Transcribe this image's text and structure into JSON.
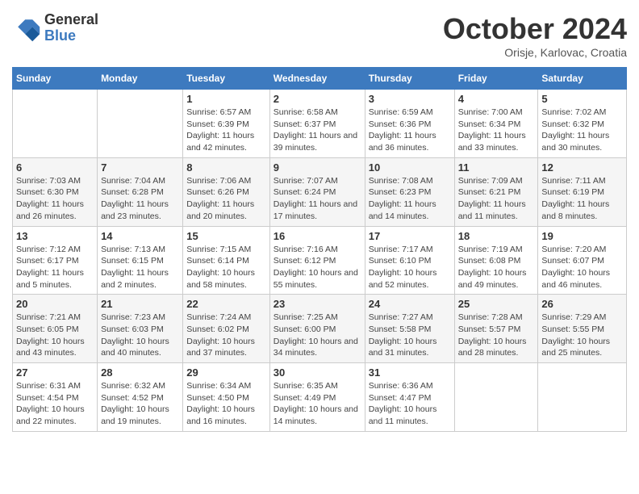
{
  "header": {
    "logo_line1": "General",
    "logo_line2": "Blue",
    "month": "October 2024",
    "location": "Orisje, Karlovac, Croatia"
  },
  "weekdays": [
    "Sunday",
    "Monday",
    "Tuesday",
    "Wednesday",
    "Thursday",
    "Friday",
    "Saturday"
  ],
  "weeks": [
    [
      {
        "day": "",
        "sunrise": "",
        "sunset": "",
        "daylight": ""
      },
      {
        "day": "",
        "sunrise": "",
        "sunset": "",
        "daylight": ""
      },
      {
        "day": "1",
        "sunrise": "Sunrise: 6:57 AM",
        "sunset": "Sunset: 6:39 PM",
        "daylight": "Daylight: 11 hours and 42 minutes."
      },
      {
        "day": "2",
        "sunrise": "Sunrise: 6:58 AM",
        "sunset": "Sunset: 6:37 PM",
        "daylight": "Daylight: 11 hours and 39 minutes."
      },
      {
        "day": "3",
        "sunrise": "Sunrise: 6:59 AM",
        "sunset": "Sunset: 6:36 PM",
        "daylight": "Daylight: 11 hours and 36 minutes."
      },
      {
        "day": "4",
        "sunrise": "Sunrise: 7:00 AM",
        "sunset": "Sunset: 6:34 PM",
        "daylight": "Daylight: 11 hours and 33 minutes."
      },
      {
        "day": "5",
        "sunrise": "Sunrise: 7:02 AM",
        "sunset": "Sunset: 6:32 PM",
        "daylight": "Daylight: 11 hours and 30 minutes."
      }
    ],
    [
      {
        "day": "6",
        "sunrise": "Sunrise: 7:03 AM",
        "sunset": "Sunset: 6:30 PM",
        "daylight": "Daylight: 11 hours and 26 minutes."
      },
      {
        "day": "7",
        "sunrise": "Sunrise: 7:04 AM",
        "sunset": "Sunset: 6:28 PM",
        "daylight": "Daylight: 11 hours and 23 minutes."
      },
      {
        "day": "8",
        "sunrise": "Sunrise: 7:06 AM",
        "sunset": "Sunset: 6:26 PM",
        "daylight": "Daylight: 11 hours and 20 minutes."
      },
      {
        "day": "9",
        "sunrise": "Sunrise: 7:07 AM",
        "sunset": "Sunset: 6:24 PM",
        "daylight": "Daylight: 11 hours and 17 minutes."
      },
      {
        "day": "10",
        "sunrise": "Sunrise: 7:08 AM",
        "sunset": "Sunset: 6:23 PM",
        "daylight": "Daylight: 11 hours and 14 minutes."
      },
      {
        "day": "11",
        "sunrise": "Sunrise: 7:09 AM",
        "sunset": "Sunset: 6:21 PM",
        "daylight": "Daylight: 11 hours and 11 minutes."
      },
      {
        "day": "12",
        "sunrise": "Sunrise: 7:11 AM",
        "sunset": "Sunset: 6:19 PM",
        "daylight": "Daylight: 11 hours and 8 minutes."
      }
    ],
    [
      {
        "day": "13",
        "sunrise": "Sunrise: 7:12 AM",
        "sunset": "Sunset: 6:17 PM",
        "daylight": "Daylight: 11 hours and 5 minutes."
      },
      {
        "day": "14",
        "sunrise": "Sunrise: 7:13 AM",
        "sunset": "Sunset: 6:15 PM",
        "daylight": "Daylight: 11 hours and 2 minutes."
      },
      {
        "day": "15",
        "sunrise": "Sunrise: 7:15 AM",
        "sunset": "Sunset: 6:14 PM",
        "daylight": "Daylight: 10 hours and 58 minutes."
      },
      {
        "day": "16",
        "sunrise": "Sunrise: 7:16 AM",
        "sunset": "Sunset: 6:12 PM",
        "daylight": "Daylight: 10 hours and 55 minutes."
      },
      {
        "day": "17",
        "sunrise": "Sunrise: 7:17 AM",
        "sunset": "Sunset: 6:10 PM",
        "daylight": "Daylight: 10 hours and 52 minutes."
      },
      {
        "day": "18",
        "sunrise": "Sunrise: 7:19 AM",
        "sunset": "Sunset: 6:08 PM",
        "daylight": "Daylight: 10 hours and 49 minutes."
      },
      {
        "day": "19",
        "sunrise": "Sunrise: 7:20 AM",
        "sunset": "Sunset: 6:07 PM",
        "daylight": "Daylight: 10 hours and 46 minutes."
      }
    ],
    [
      {
        "day": "20",
        "sunrise": "Sunrise: 7:21 AM",
        "sunset": "Sunset: 6:05 PM",
        "daylight": "Daylight: 10 hours and 43 minutes."
      },
      {
        "day": "21",
        "sunrise": "Sunrise: 7:23 AM",
        "sunset": "Sunset: 6:03 PM",
        "daylight": "Daylight: 10 hours and 40 minutes."
      },
      {
        "day": "22",
        "sunrise": "Sunrise: 7:24 AM",
        "sunset": "Sunset: 6:02 PM",
        "daylight": "Daylight: 10 hours and 37 minutes."
      },
      {
        "day": "23",
        "sunrise": "Sunrise: 7:25 AM",
        "sunset": "Sunset: 6:00 PM",
        "daylight": "Daylight: 10 hours and 34 minutes."
      },
      {
        "day": "24",
        "sunrise": "Sunrise: 7:27 AM",
        "sunset": "Sunset: 5:58 PM",
        "daylight": "Daylight: 10 hours and 31 minutes."
      },
      {
        "day": "25",
        "sunrise": "Sunrise: 7:28 AM",
        "sunset": "Sunset: 5:57 PM",
        "daylight": "Daylight: 10 hours and 28 minutes."
      },
      {
        "day": "26",
        "sunrise": "Sunrise: 7:29 AM",
        "sunset": "Sunset: 5:55 PM",
        "daylight": "Daylight: 10 hours and 25 minutes."
      }
    ],
    [
      {
        "day": "27",
        "sunrise": "Sunrise: 6:31 AM",
        "sunset": "Sunset: 4:54 PM",
        "daylight": "Daylight: 10 hours and 22 minutes."
      },
      {
        "day": "28",
        "sunrise": "Sunrise: 6:32 AM",
        "sunset": "Sunset: 4:52 PM",
        "daylight": "Daylight: 10 hours and 19 minutes."
      },
      {
        "day": "29",
        "sunrise": "Sunrise: 6:34 AM",
        "sunset": "Sunset: 4:50 PM",
        "daylight": "Daylight: 10 hours and 16 minutes."
      },
      {
        "day": "30",
        "sunrise": "Sunrise: 6:35 AM",
        "sunset": "Sunset: 4:49 PM",
        "daylight": "Daylight: 10 hours and 14 minutes."
      },
      {
        "day": "31",
        "sunrise": "Sunrise: 6:36 AM",
        "sunset": "Sunset: 4:47 PM",
        "daylight": "Daylight: 10 hours and 11 minutes."
      },
      {
        "day": "",
        "sunrise": "",
        "sunset": "",
        "daylight": ""
      },
      {
        "day": "",
        "sunrise": "",
        "sunset": "",
        "daylight": ""
      }
    ]
  ]
}
